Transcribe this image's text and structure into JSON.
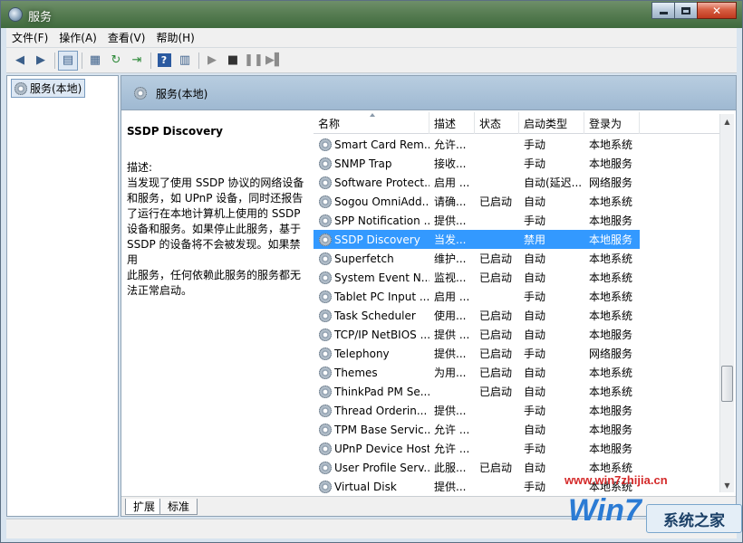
{
  "window": {
    "title": "服务",
    "caption_buttons": [
      "minimize",
      "maximize",
      "close"
    ]
  },
  "menu": [
    "文件(F)",
    "操作(A)",
    "查看(V)",
    "帮助(H)"
  ],
  "toolbar": {
    "icons": [
      "back-arrow-icon",
      "forward-arrow-icon",
      "console-tree-icon",
      "properties-icon",
      "refresh-icon",
      "export-icon",
      "help-icon",
      "action-pane-icon",
      "start-icon",
      "stop-icon",
      "pause-icon",
      "restart-icon"
    ]
  },
  "tree": {
    "item": "服务(本地)"
  },
  "pane_header": "服务(本地)",
  "description": {
    "service": "SSDP Discovery",
    "label": "描述:",
    "lines": [
      "当发现了使用 SSDP 协议的网络设备",
      "和服务，如 UPnP 设备，同时还报告",
      "了运行在本地计算机上使用的 SSDP",
      "设备和服务。如果停止此服务，基于",
      "SSDP 的设备将不会被发现。如果禁用",
      "此服务，任何依赖此服务的服务都无",
      "法正常启动。"
    ]
  },
  "columns": [
    "名称",
    "描述",
    "状态",
    "启动类型",
    "登录为"
  ],
  "services": [
    {
      "name": "Smart Card Rem...",
      "desc": "允许...",
      "status": "",
      "startup": "手动",
      "logon": "本地系统"
    },
    {
      "name": "SNMP Trap",
      "desc": "接收...",
      "status": "",
      "startup": "手动",
      "logon": "本地服务"
    },
    {
      "name": "Software Protect...",
      "desc": "启用 ...",
      "status": "",
      "startup": "自动(延迟...",
      "logon": "网络服务"
    },
    {
      "name": "Sogou OmniAdd...",
      "desc": "请确...",
      "status": "已启动",
      "startup": "自动",
      "logon": "本地系统"
    },
    {
      "name": "SPP Notification ...",
      "desc": "提供...",
      "status": "",
      "startup": "手动",
      "logon": "本地服务"
    },
    {
      "name": "SSDP Discovery",
      "desc": "当发...",
      "status": "",
      "startup": "禁用",
      "logon": "本地服务"
    },
    {
      "name": "Superfetch",
      "desc": "维护...",
      "status": "已启动",
      "startup": "自动",
      "logon": "本地系统"
    },
    {
      "name": "System Event N...",
      "desc": "监视...",
      "status": "已启动",
      "startup": "自动",
      "logon": "本地系统"
    },
    {
      "name": "Tablet PC Input ...",
      "desc": "启用 ...",
      "status": "",
      "startup": "手动",
      "logon": "本地系统"
    },
    {
      "name": "Task Scheduler",
      "desc": "使用...",
      "status": "已启动",
      "startup": "自动",
      "logon": "本地系统"
    },
    {
      "name": "TCP/IP NetBIOS ...",
      "desc": "提供 ...",
      "status": "已启动",
      "startup": "自动",
      "logon": "本地服务"
    },
    {
      "name": "Telephony",
      "desc": "提供...",
      "status": "已启动",
      "startup": "手动",
      "logon": "网络服务"
    },
    {
      "name": "Themes",
      "desc": "为用...",
      "status": "已启动",
      "startup": "自动",
      "logon": "本地系统"
    },
    {
      "name": "ThinkPad PM Se...",
      "desc": "",
      "status": "已启动",
      "startup": "自动",
      "logon": "本地系统"
    },
    {
      "name": "Thread Orderin...",
      "desc": "提供...",
      "status": "",
      "startup": "手动",
      "logon": "本地服务"
    },
    {
      "name": "TPM Base Servic...",
      "desc": "允许 ...",
      "status": "",
      "startup": "自动",
      "logon": "本地服务"
    },
    {
      "name": "UPnP Device Host",
      "desc": "允许 ...",
      "status": "",
      "startup": "手动",
      "logon": "本地服务"
    },
    {
      "name": "User Profile Serv...",
      "desc": "此服...",
      "status": "已启动",
      "startup": "自动",
      "logon": "本地系统"
    },
    {
      "name": "Virtual Disk",
      "desc": "提供...",
      "status": "",
      "startup": "手动",
      "logon": "本地系统"
    }
  ],
  "selected_service": "SSDP Discovery",
  "tabs": [
    "扩展",
    "标准"
  ],
  "active_tab": "扩展",
  "watermark": {
    "url": "www.win7zhijia.cn",
    "logo_text": "Win7",
    "badge": "系统之家"
  },
  "colors": {
    "selection": "#3399ff",
    "header_band": "#a9c2d9",
    "watermark_red": "#d42a2a"
  }
}
